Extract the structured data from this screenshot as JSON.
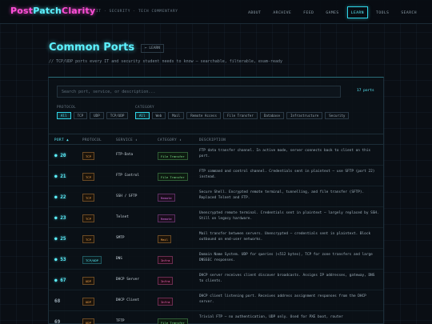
{
  "header": {
    "logo_part1": "Post",
    "logo_part2": "Patch",
    "logo_part3": "Clarity",
    "tagline": "IT · SECURITY · TECH COMMENTARY",
    "nav": [
      "ABOUT",
      "ARCHIVE",
      "FEED",
      "GAMES",
      "LEARN",
      "TOOLS",
      "SEARCH"
    ],
    "active_nav": "LEARN"
  },
  "page": {
    "title": "Common Ports",
    "back_label": "← LEARN",
    "subtitle": "// TCP/UDP ports every IT and security student needs to know — searchable, filterable, exam-ready"
  },
  "search": {
    "placeholder": "Search port, service, or description...",
    "count": "17 ports"
  },
  "filters": {
    "protocol_label": "PROTOCOL",
    "protocol_options": [
      "All",
      "TCP",
      "UDP",
      "TCP/UDP"
    ],
    "category_label": "CATEGORY",
    "category_options": [
      "All",
      "Web",
      "Mail",
      "Remote Access",
      "File Transfer",
      "Database",
      "Infrastructure",
      "Security"
    ]
  },
  "table": {
    "headers": [
      "PORT ▲",
      "PROTOCOL",
      "SERVICE ↕",
      "CATEGORY ↕",
      "DESCRIPTION"
    ],
    "rows": [
      {
        "port": "20",
        "marker": true,
        "protocol": "TCP",
        "service": "FTP-Data",
        "category": "File Transfer",
        "cat_class": "file",
        "description": "FTP data transfer channel. In active mode, server connects back to client on this port."
      },
      {
        "port": "21",
        "marker": true,
        "protocol": "TCP",
        "service": "FTP Control",
        "category": "File Transfer",
        "cat_class": "file",
        "description": "FTP command and control channel. Credentials sent in plaintext — use SFTP (port 22) instead."
      },
      {
        "port": "22",
        "marker": true,
        "protocol": "TCP",
        "service": "SSH / SFTP",
        "category": "Remote",
        "cat_class": "remote",
        "description": "Secure Shell. Encrypted remote terminal, tunnelling, and file transfer (SFTP). Replaced Telnet and FTP."
      },
      {
        "port": "23",
        "marker": true,
        "protocol": "TCP",
        "service": "Telnet",
        "category": "Remote",
        "cat_class": "remote",
        "description": "Unencrypted remote terminal. Credentials sent in plaintext — largely replaced by SSH. Still on legacy hardware."
      },
      {
        "port": "25",
        "marker": true,
        "protocol": "TCP",
        "service": "SMTP",
        "category": "Mail",
        "cat_class": "mail",
        "description": "Mail transfer between servers. Unencrypted — credentials sent in plaintext. Block outbound on end-user networks."
      },
      {
        "port": "53",
        "marker": true,
        "protocol": "TCP/UDP",
        "service": "DNS",
        "category": "Infra",
        "cat_class": "infra",
        "description": "Domain Name System. UDP for queries (<512 bytes), TCP for zone transfers and large DNSSEC responses."
      },
      {
        "port": "67",
        "marker": true,
        "protocol": "UDP",
        "service": "DHCP Server",
        "category": "Infra",
        "cat_class": "infra",
        "description": "DHCP server receives client discover broadcasts. Assigns IP addresses, gateway, DNS to clients."
      },
      {
        "port": "68",
        "marker": false,
        "protocol": "UDP",
        "service": "DHCP Client",
        "category": "Infra",
        "cat_class": "infra",
        "description": "DHCP client listening port. Receives address assignment responses from the DHCP server."
      },
      {
        "port": "69",
        "marker": false,
        "protocol": "UDP",
        "service": "TFTP",
        "category": "File Transfer",
        "cat_class": "file",
        "description": "Trivial FTP — no authentication, UDP only. Used for PXE boot, router"
      }
    ]
  },
  "colors": {
    "accent": "#5cf2ff",
    "brand_pink": "#ff4fd8",
    "background": "#0a0e14"
  }
}
